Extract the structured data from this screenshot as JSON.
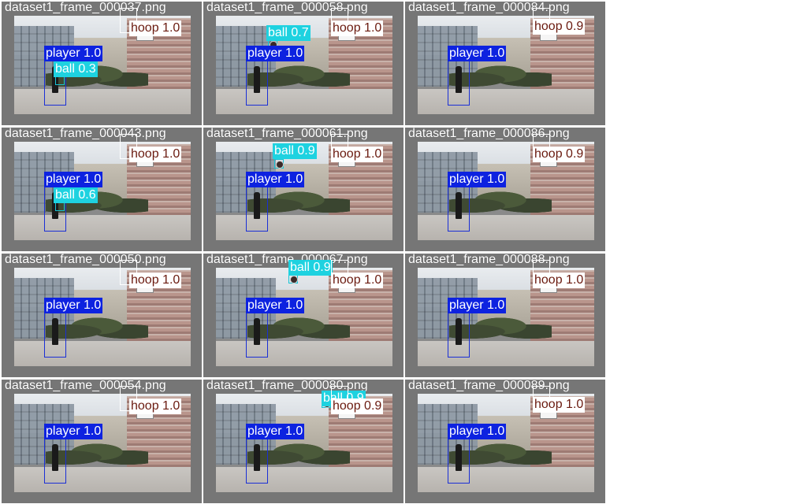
{
  "colors": {
    "player": "#0d22e0",
    "hoop_label_bg": "#ffffff",
    "hoop_text": "#6a1a0f",
    "ball": "#1ed2e0",
    "tile_bg": "#767676"
  },
  "tiles": [
    {
      "filename": "dataset1_frame_000037.png",
      "detections": [
        {
          "cls": "hoop",
          "label": "hoop 1.0"
        },
        {
          "cls": "player",
          "label": "player 1.0"
        },
        {
          "cls": "ball",
          "label": "ball 0.3"
        }
      ]
    },
    {
      "filename": "dataset1_frame_000058.png",
      "detections": [
        {
          "cls": "ball",
          "label": "ball 0.7"
        },
        {
          "cls": "hoop",
          "label": "hoop 1.0"
        },
        {
          "cls": "player",
          "label": "player 1.0"
        }
      ]
    },
    {
      "filename": "dataset1_frame_000084.png",
      "detections": [
        {
          "cls": "hoop",
          "label": "hoop 0.9"
        },
        {
          "cls": "player",
          "label": "player 1.0"
        }
      ]
    },
    {
      "filename": "dataset1_frame_000043.png",
      "detections": [
        {
          "cls": "hoop",
          "label": "hoop 1.0"
        },
        {
          "cls": "player",
          "label": "player 1.0"
        },
        {
          "cls": "ball",
          "label": "ball 0.6"
        }
      ]
    },
    {
      "filename": "dataset1_frame_000061.png",
      "detections": [
        {
          "cls": "ball",
          "label": "ball 0.9"
        },
        {
          "cls": "hoop",
          "label": "hoop 1.0"
        },
        {
          "cls": "player",
          "label": "player 1.0"
        }
      ]
    },
    {
      "filename": "dataset1_frame_000086.png",
      "detections": [
        {
          "cls": "hoop",
          "label": "hoop 0.9"
        },
        {
          "cls": "player",
          "label": "player 1.0"
        }
      ]
    },
    {
      "filename": "dataset1_frame_000050.png",
      "detections": [
        {
          "cls": "hoop",
          "label": "hoop 1.0"
        },
        {
          "cls": "player",
          "label": "player 1.0"
        }
      ]
    },
    {
      "filename": "dataset1_frame_000067.png",
      "detections": [
        {
          "cls": "ball",
          "label": "ball 0.9"
        },
        {
          "cls": "hoop",
          "label": "hoop 1.0"
        },
        {
          "cls": "player",
          "label": "player 1.0"
        }
      ]
    },
    {
      "filename": "dataset1_frame_000088.png",
      "detections": [
        {
          "cls": "hoop",
          "label": "hoop 1.0"
        },
        {
          "cls": "player",
          "label": "player 1.0"
        }
      ]
    },
    {
      "filename": "dataset1_frame_000054.png",
      "detections": [
        {
          "cls": "hoop",
          "label": "hoop 1.0"
        },
        {
          "cls": "player",
          "label": "player 1.0"
        }
      ]
    },
    {
      "filename": "dataset1_frame_000080.png",
      "detections": [
        {
          "cls": "ball",
          "label": "ball 0.9"
        },
        {
          "cls": "hoop",
          "label": "hoop 0.9"
        },
        {
          "cls": "player",
          "label": "player 1.0"
        }
      ]
    },
    {
      "filename": "dataset1_frame_000089.png",
      "detections": [
        {
          "cls": "hoop",
          "label": "hoop 1.0"
        },
        {
          "cls": "player",
          "label": "player 1.0"
        }
      ]
    }
  ]
}
